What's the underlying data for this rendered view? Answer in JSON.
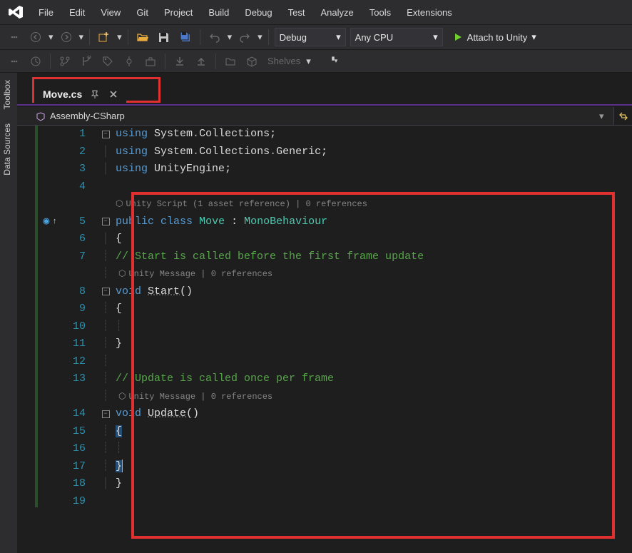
{
  "menu": {
    "items": [
      "File",
      "Edit",
      "View",
      "Git",
      "Project",
      "Build",
      "Debug",
      "Test",
      "Analyze",
      "Tools",
      "Extensions"
    ]
  },
  "toolbar": {
    "config": "Debug",
    "platform": "Any CPU",
    "run": "Attach to Unity",
    "shelves": "Shelves"
  },
  "sidetabs": {
    "toolbox": "Toolbox",
    "datasources": "Data Sources"
  },
  "tab": {
    "name": "Move.cs"
  },
  "navbar": {
    "project": "Assembly-CSharp"
  },
  "code": {
    "l1a": "using",
    "l1b": "System",
    "l1c": "Collections",
    "l2a": "using",
    "l2b": "System",
    "l2c": "Collections",
    "l2d": "Generic",
    "l3a": "using",
    "l3b": "UnityEngine",
    "lens1": "Unity Script (1 asset reference) | 0 references",
    "l5a": "public",
    "l5b": "class",
    "l5c": "Move",
    "l5d": "MonoBehaviour",
    "cm1": "// Start is called before the first frame update",
    "lens2": "Unity Message | 0 references",
    "l8a": "void",
    "l8b": "Start",
    "cm2": "// Update is called once per frame",
    "lens3": "Unity Message | 0 references",
    "l14a": "void",
    "l14b": "Update",
    "ob": "{",
    "cb": "}"
  }
}
